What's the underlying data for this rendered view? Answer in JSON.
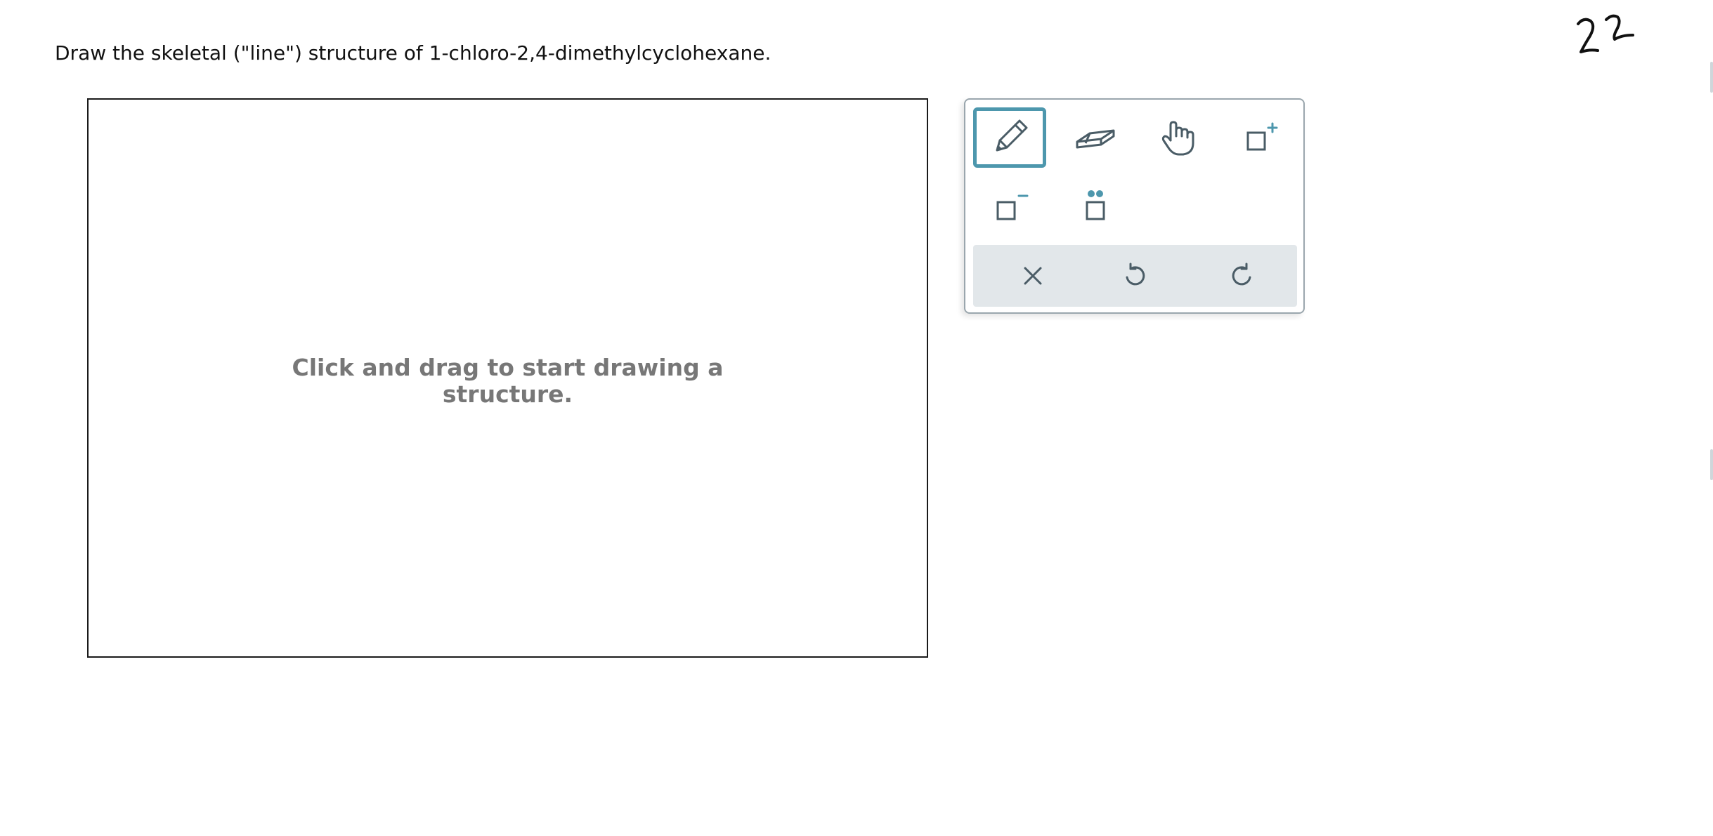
{
  "question": {
    "prompt": "Draw the skeletal (\"line\") structure of 1-chloro-2,4-dimethylcyclohexane."
  },
  "canvas": {
    "hint_line_1": "Click and drag to start drawing a",
    "hint_line_2": "structure."
  },
  "toolbox": {
    "tools": [
      {
        "name": "pencil",
        "icon": "pencil-icon",
        "active": true
      },
      {
        "name": "eraser",
        "icon": "eraser-icon",
        "active": false
      },
      {
        "name": "move",
        "icon": "hand-icon",
        "active": false
      },
      {
        "name": "add-positive-charge",
        "icon": "positive-charge-icon",
        "active": false
      },
      {
        "name": "add-negative-charge",
        "icon": "negative-charge-icon",
        "active": false
      },
      {
        "name": "add-lone-pair",
        "icon": "lone-pair-icon",
        "active": false
      }
    ],
    "actions": [
      {
        "name": "clear",
        "icon": "close-icon"
      },
      {
        "name": "undo",
        "icon": "undo-icon"
      },
      {
        "name": "redo",
        "icon": "redo-icon"
      }
    ]
  },
  "colors": {
    "accent": "#4d97ad",
    "icon": "#4a5c66",
    "action_bar_bg": "#e2e7ea",
    "hint_text": "#777777"
  },
  "handwritten_annotation": "22"
}
